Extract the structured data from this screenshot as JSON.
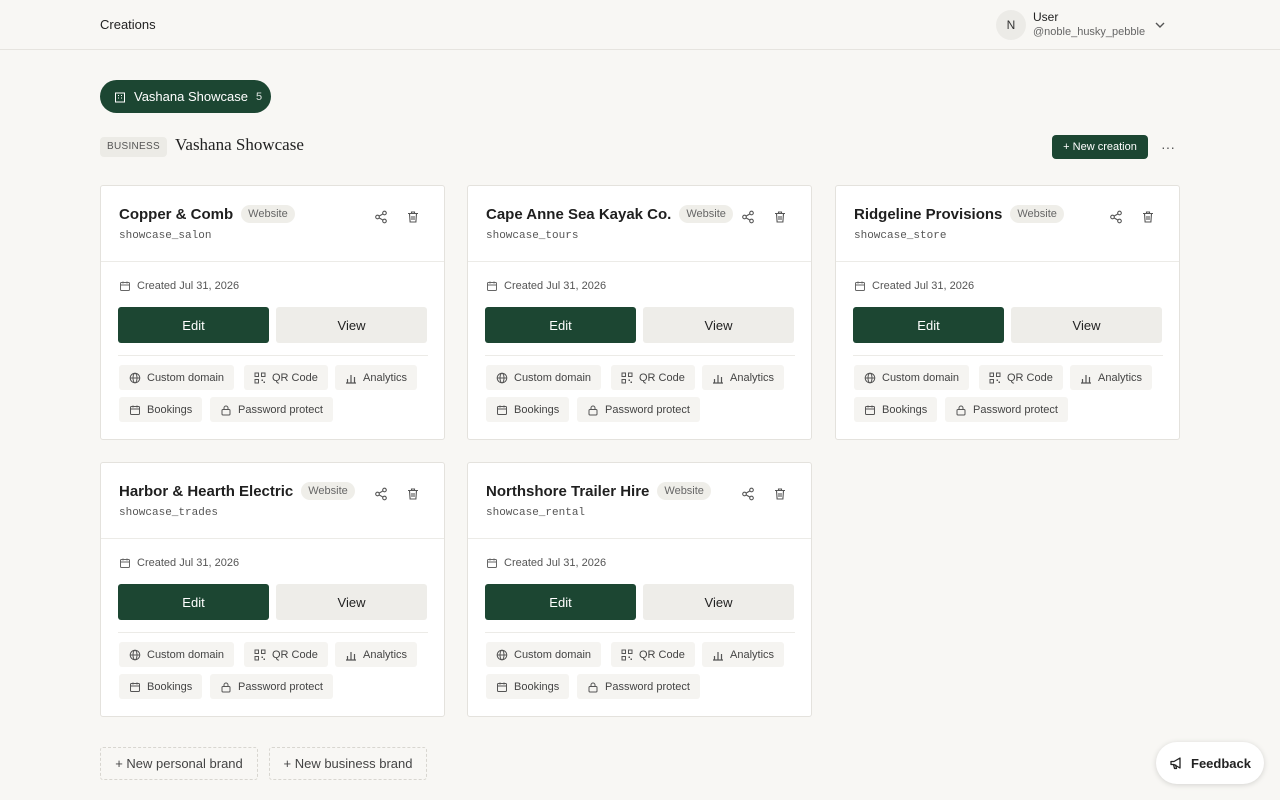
{
  "topbar": {
    "title": "Creations"
  },
  "user": {
    "initial": "N",
    "name": "User",
    "handle": "@noble_husky_pebble"
  },
  "brand": {
    "name": "Vashana Showcase",
    "count": "5"
  },
  "section": {
    "badge": "BUSINESS",
    "name": "Vashana Showcase",
    "new_label": "+ New creation",
    "more_label": "···"
  },
  "cards": [
    {
      "title": "Copper & Comb",
      "tag": "Website",
      "slug": "showcase_salon",
      "created": "Created Jul 31, 2026"
    },
    {
      "title": "Cape Anne Sea Kayak Co.",
      "tag": "Website",
      "slug": "showcase_tours",
      "created": "Created Jul 31, 2026"
    },
    {
      "title": "Ridgeline Provisions",
      "tag": "Website",
      "slug": "showcase_store",
      "created": "Created Jul 31, 2026"
    },
    {
      "title": "Harbor & Hearth Electric",
      "tag": "Website",
      "slug": "showcase_trades",
      "created": "Created Jul 31, 2026"
    },
    {
      "title": "Northshore Trailer Hire",
      "tag": "Website",
      "slug": "showcase_rental",
      "created": "Created Jul 31, 2026"
    }
  ],
  "card_labels": {
    "edit": "Edit",
    "view": "View",
    "custom_domain": "Custom domain",
    "qr_code": "QR Code",
    "analytics": "Analytics",
    "bookings": "Bookings",
    "password_protect": "Password protect"
  },
  "footer": {
    "new_personal": "+ New personal brand",
    "new_business": "+ New business brand",
    "feedback": "Feedback"
  },
  "colors": {
    "accent": "#1c4632",
    "background": "#f8f7f4",
    "card": "#ffffff"
  }
}
